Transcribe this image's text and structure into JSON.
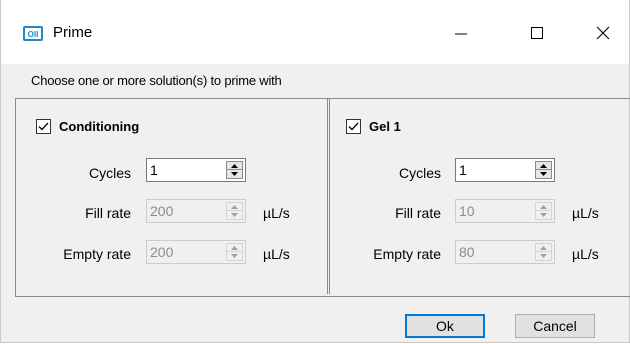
{
  "window": {
    "title": "Prime",
    "controls": [
      "minimize-icon",
      "maximize-icon",
      "close-icon"
    ]
  },
  "instruction": "Choose one or more solution(s) to prime with",
  "panels": [
    {
      "checkbox_label": "Conditioning",
      "checked": true,
      "cycles_label": "Cycles",
      "cycles_value": "1",
      "fill_rate_label": "Fill rate",
      "fill_rate_value": "200",
      "empty_rate_label": "Empty rate",
      "empty_rate_value": "200",
      "unit": "µL/s"
    },
    {
      "checkbox_label": "Gel 1",
      "checked": true,
      "cycles_label": "Cycles",
      "cycles_value": "1",
      "fill_rate_label": "Fill rate",
      "fill_rate_value": "10",
      "empty_rate_label": "Empty rate",
      "empty_rate_value": "80",
      "unit": "µL/s"
    }
  ],
  "buttons": {
    "ok_label": "Ok",
    "cancel_label": "Cancel"
  },
  "colors": {
    "accent": "#0078d7",
    "disabled_text": "#8c8c8c"
  }
}
